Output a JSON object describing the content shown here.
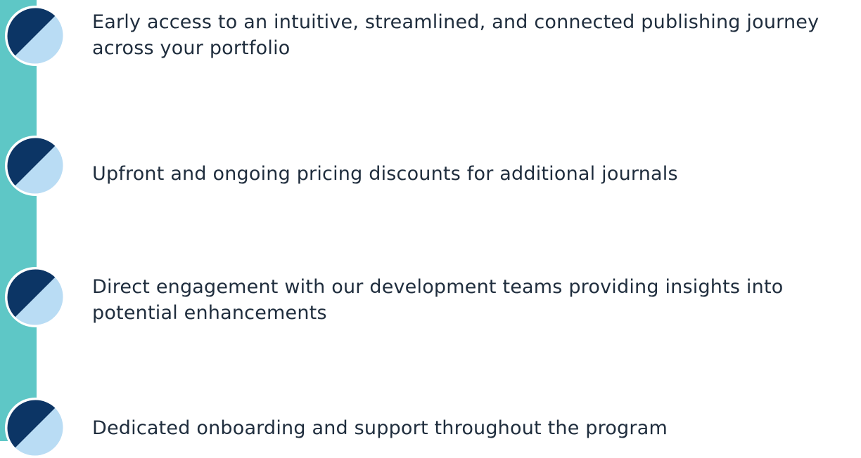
{
  "colors": {
    "accent_bar": "#5ec7c6",
    "badge_dark": "#0c3565",
    "badge_light": "#b9dcf4",
    "badge_ring": "#ffffff",
    "text": "#1f2d3d"
  },
  "benefits": [
    {
      "icon": "half-circle-badge-icon",
      "text": "Early access to an intuitive, streamlined, and connected publishing journey across your portfolio"
    },
    {
      "icon": "half-circle-badge-icon",
      "text": "Upfront and ongoing pricing discounts for additional journals"
    },
    {
      "icon": "half-circle-badge-icon",
      "text": "Direct engagement with our development teams providing insights into potential enhancements"
    },
    {
      "icon": "half-circle-badge-icon",
      "text": "Dedicated onboarding and support throughout the program"
    }
  ]
}
